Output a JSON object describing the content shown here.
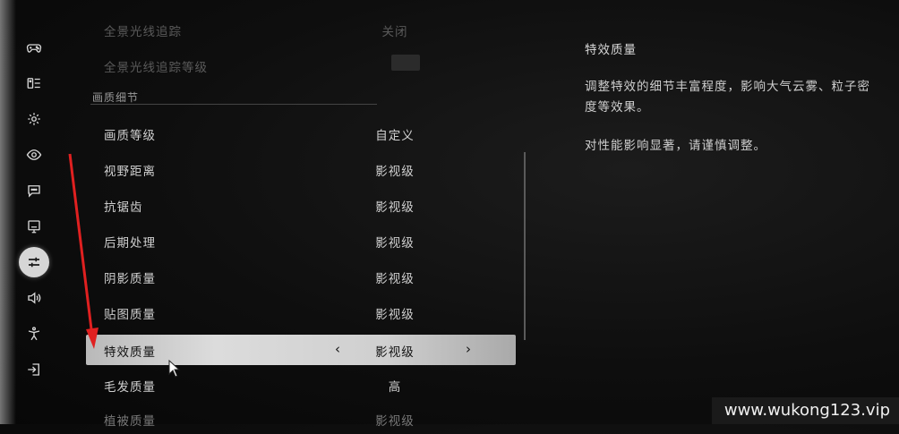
{
  "sidebar": {
    "items": [
      {
        "icon": "gamepad-icon"
      },
      {
        "icon": "keyboard-icon"
      },
      {
        "icon": "gear-icon"
      },
      {
        "icon": "eye-icon"
      },
      {
        "icon": "chat-icon"
      },
      {
        "icon": "monitor-icon"
      },
      {
        "icon": "sliders-icon",
        "active": true
      },
      {
        "icon": "speaker-icon"
      },
      {
        "icon": "accessibility-icon"
      },
      {
        "icon": "exit-icon"
      }
    ]
  },
  "settings": {
    "top_rows": [
      {
        "label": "全景光线追踪",
        "value": "关闭"
      },
      {
        "label": "全景光线追踪等级",
        "value": ""
      }
    ],
    "section_title": "画质细节",
    "rows": [
      {
        "label": "画质等级",
        "value": "自定义"
      },
      {
        "label": "视野距离",
        "value": "影视级"
      },
      {
        "label": "抗锯齿",
        "value": "影视级"
      },
      {
        "label": "后期处理",
        "value": "影视级"
      },
      {
        "label": "阴影质量",
        "value": "影视级"
      },
      {
        "label": "贴图质量",
        "value": "影视级"
      },
      {
        "label": "特效质量",
        "value": "影视级",
        "selected": true
      },
      {
        "label": "毛发质量",
        "value": "高"
      },
      {
        "label": "植被质量",
        "value": "影视级"
      }
    ],
    "arrow_left": "‹",
    "arrow_right": "›"
  },
  "description": {
    "title": "特效质量",
    "paragraphs": [
      "调整特效的细节丰富程度，影响大气云雾、粒子密度等效果。",
      "对性能影响显著，请谨慎调整。"
    ]
  },
  "watermark": "www.wukong123.vip",
  "colors": {
    "selected_bar": "#d4d4d4",
    "annotation_arrow": "#e02020"
  }
}
